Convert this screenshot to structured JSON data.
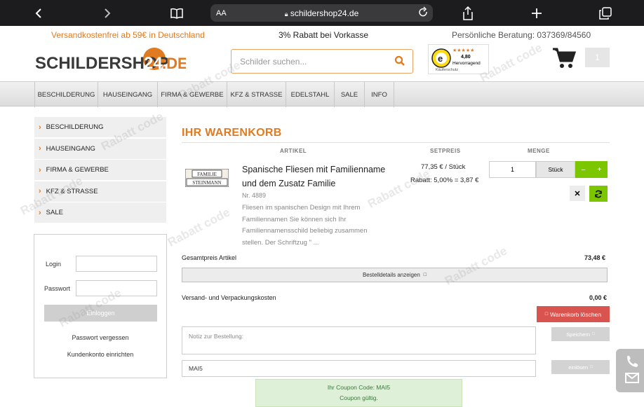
{
  "browser": {
    "text_size_label": "AA",
    "url": "schildershop24.de"
  },
  "promo": {
    "left": "Versandkostenfrei ab 59€ in Deutschland",
    "center": "3% Rabatt bei Vorkasse",
    "right": "Persönliche Beratung: 037369/84560"
  },
  "header": {
    "logo_main": "SCHILDERSHOP",
    "logo_num": "24",
    "logo_tld": ".DE",
    "search_placeholder": "Schilder suchen...",
    "trust_rating": "4,80",
    "trust_label": "Hervorragend",
    "trust_sub": "Käuferschutz",
    "cart_count": "1"
  },
  "nav": [
    "BESCHILDERUNG",
    "HAUSEINGANG",
    "FIRMA & GEWERBE",
    "KFZ & STRASSE",
    "EDELSTAHL",
    "SALE",
    "INFO"
  ],
  "sidebar": [
    "BESCHILDERUNG",
    "HAUSEINGANG",
    "FIRMA & GEWERBE",
    "KFZ & STRASSE",
    "SALE"
  ],
  "login": {
    "login_label": "Login",
    "password_label": "Passwort",
    "button": "Einloggen",
    "forgot": "Passwort vergessen",
    "register": "Kundenkonto einrichten"
  },
  "cart": {
    "title": "IHR WARENKORB",
    "col_article": "ARTIKEL",
    "col_price": "SETPREIS",
    "col_qty": "MENGE",
    "thumb_text_1": "FAMILIE",
    "thumb_text_2": "STEINMANN",
    "product_name": "Spanische Fliesen mit Familienname und dem Zusatz Familie",
    "product_nr": "Nr. 4889",
    "product_desc": "Fliesen im spanischen Design mit Ihrem Familiennamen Sie können sich Ihr Familiennamensschild beliebig zusammen stellen. Der Schriftzug \" ...",
    "unit_price": "77,35 € / Stück",
    "discount": "Rabatt: 5,00% = 3,87 €",
    "qty": "1",
    "unit": "Stück",
    "minus": "–",
    "plus": "+",
    "delete_glyph": "✕",
    "total_label": "Gesamtpreis Artikel",
    "total_value": "73,48 €",
    "details_button": "Bestelldetails anzeigen",
    "shipping_label": "Versand- und Verpackungskosten",
    "shipping_value": "0,00 €",
    "delete_cart_button": "Warenkorb löschen",
    "note_placeholder": "Notiz zur Bestellung:",
    "save_button": "Speichern",
    "coupon_value": "MAI5",
    "redeem_button": "einlösen",
    "coupon_msg_1": "Ihr Coupon Code: MAI5",
    "coupon_msg_2": "Coupon gültig."
  },
  "colors": {
    "accent_orange": "#e07b22",
    "green": "#7cc600",
    "danger": "#d9534f",
    "safari_bar": "#1c1c1e"
  },
  "watermark": {
    "text": "Rabatt code"
  }
}
